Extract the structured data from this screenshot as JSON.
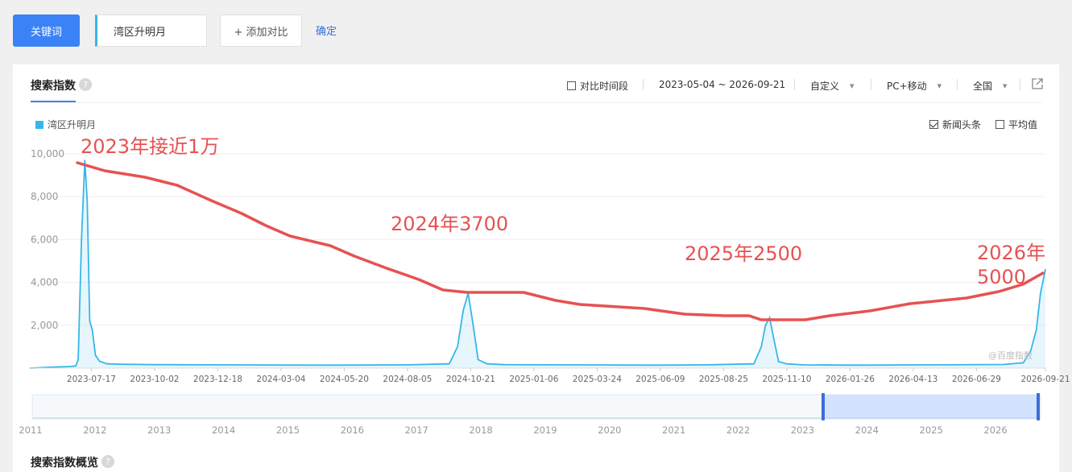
{
  "toolbar": {
    "keyword_button": "关键词",
    "keyword_value": "湾区升明月",
    "add_compare": "+ 添加对比",
    "confirm": "确定"
  },
  "panel": {
    "title": "搜索指数",
    "help": "?",
    "compare_period": "对比时间段",
    "date_range": "2023-05-04 ~ 2026-09-21",
    "custom": "自定义",
    "device": "PC+移动",
    "region": "全国",
    "news_label": "新闻头条",
    "avg_label": "平均值",
    "overview_title": "搜索指数概览",
    "watermark": "@百度指数"
  },
  "icons": {
    "help": "help-icon",
    "export": "export-icon",
    "caret": "caret-down-icon"
  },
  "colors": {
    "brand": "#3b82f6",
    "series": "#37b6e8",
    "annotation": "#e65252"
  },
  "chart_data": {
    "type": "line",
    "title": "",
    "xlabel": "",
    "ylabel": "",
    "ylim": [
      0,
      10000
    ],
    "yticks": [
      "10,000",
      "8,000",
      "6,000",
      "4,000",
      "2,000"
    ],
    "xticks": [
      "2023-07-17",
      "2023-10-02",
      "2023-12-18",
      "2024-03-04",
      "2024-05-20",
      "2024-08-05",
      "2024-10-21",
      "2025-01-06",
      "2025-03-24",
      "2025-06-09",
      "2025-08-25",
      "2025-11-10",
      "2026-01-26",
      "2026-04-13",
      "2026-06-29",
      "2026-09-21"
    ],
    "legend": [
      "湾区升明月"
    ],
    "legend_position": "top-left",
    "grid": true,
    "series": [
      {
        "name": "湾区升明月",
        "color": "#37b6e8",
        "x": [
          "2023-05-04",
          "2023-06-01",
          "2023-06-20",
          "2023-06-28",
          "2023-07-01",
          "2023-07-05",
          "2023-07-09",
          "2023-07-12",
          "2023-07-15",
          "2023-07-18",
          "2023-07-22",
          "2023-07-27",
          "2023-08-05",
          "2023-08-20",
          "2023-10-01",
          "2024-01-01",
          "2024-05-01",
          "2024-08-01",
          "2024-09-25",
          "2024-10-05",
          "2024-10-12",
          "2024-10-18",
          "2024-10-24",
          "2024-10-30",
          "2024-11-10",
          "2024-12-01",
          "2025-03-01",
          "2025-06-01",
          "2025-08-01",
          "2025-10-01",
          "2025-10-10",
          "2025-10-15",
          "2025-10-20",
          "2025-10-25",
          "2025-10-31",
          "2025-11-10",
          "2025-12-01",
          "2026-02-01",
          "2026-05-01",
          "2026-08-01",
          "2026-08-25",
          "2026-09-03",
          "2026-09-10",
          "2026-09-15",
          "2026-09-21"
        ],
        "values": [
          0,
          50,
          70,
          100,
          400,
          6000,
          9700,
          7800,
          2200,
          1800,
          600,
          320,
          200,
          180,
          160,
          150,
          140,
          150,
          200,
          1000,
          2700,
          3500,
          2000,
          400,
          200,
          160,
          150,
          140,
          150,
          200,
          1000,
          2000,
          2350,
          1400,
          300,
          200,
          150,
          140,
          150,
          170,
          250,
          800,
          1800,
          3500,
          4600
        ]
      }
    ],
    "annotations": [
      {
        "text": "2023年接近1万"
      },
      {
        "text": "2024年3700"
      },
      {
        "text": "2025年2500"
      },
      {
        "text": "2026年"
      },
      {
        "text": "5000"
      }
    ],
    "timeline_ticks": [
      "2011",
      "2012",
      "2013",
      "2014",
      "2015",
      "2016",
      "2017",
      "2018",
      "2019",
      "2020",
      "2021",
      "2022",
      "2023",
      "2024",
      "2025",
      "2026"
    ]
  }
}
